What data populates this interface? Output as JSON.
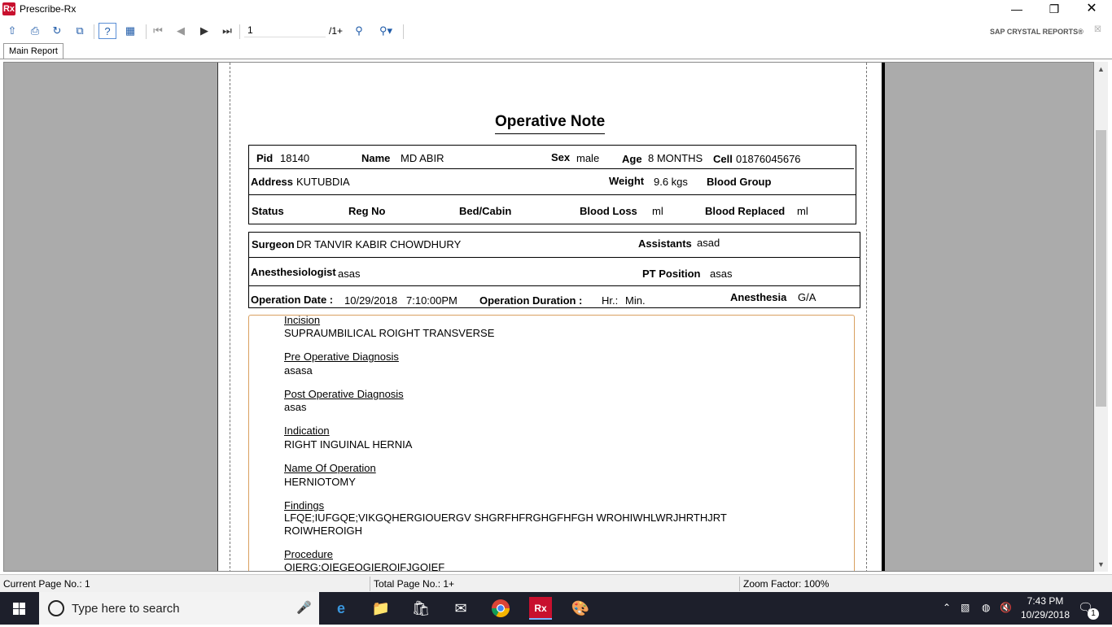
{
  "window": {
    "title": "Prescribe-Rx",
    "app_icon": "Rx"
  },
  "toolbar": {
    "page_input": "1",
    "page_total": "/1+",
    "brand": "SAP CRYSTAL REPORTS®"
  },
  "tabs": [
    {
      "label": "Main Report"
    }
  ],
  "report": {
    "title": "Operative Note",
    "patient": {
      "pid_label": "Pid",
      "pid": "18140",
      "name_label": "Name",
      "name": "MD ABIR",
      "sex_label": "Sex",
      "sex": "male",
      "age_label": "Age",
      "age": "8 MONTHS",
      "cell_label": "Cell",
      "cell": "01876045676",
      "address_label": "Address",
      "address": "KUTUBDIA",
      "weight_label": "Weight",
      "weight": "9.6 kgs",
      "blood_group_label": "Blood Group",
      "status_label": "Status",
      "reg_label": "Reg No",
      "bed_label": "Bed/Cabin",
      "blood_loss_label": "Blood Loss",
      "blood_loss_unit": "ml",
      "blood_replaced_label": "Blood Replaced",
      "blood_replaced_unit": "ml"
    },
    "operation": {
      "surgeon_label": "Surgeon",
      "surgeon": "DR TANVIR KABIR CHOWDHURY",
      "assistants_label": "Assistants",
      "assistants": "asad",
      "anesthesiologist_label": "Anesthesiologist",
      "anesthesiologist": "asas",
      "pt_position_label": "PT Position",
      "pt_position": "asas",
      "date_label": "Operation Date :",
      "date": "10/29/2018",
      "time": "7:10:00PM",
      "duration_label": "Operation Duration :",
      "duration_hr": "Hr.:",
      "duration_min": "Min.",
      "anesthesia_label": "Anesthesia",
      "anesthesia": "G/A"
    },
    "sections": [
      {
        "heading": "Incision",
        "lines": [
          "SUPRAUMBILICAL ROIGHT TRANSVERSE"
        ]
      },
      {
        "heading": "Pre Operative Diagnosis",
        "lines": [
          "asasa"
        ]
      },
      {
        "heading": "Post Operative Diagnosis",
        "lines": [
          "asas"
        ]
      },
      {
        "heading": "Indication",
        "lines": [
          "RIGHT INGUINAL HERNIA"
        ]
      },
      {
        "heading": "Name Of Operation",
        "lines": [
          "HERNIOTOMY"
        ]
      },
      {
        "heading": "Findings",
        "lines": [
          "LFQE;IUFGQE;VIKGQHERGIOUERGV  SHGRFHFRGHGFHFGH  WROHIWHLWRJHRTHJRT",
          "ROIWHEROIGH"
        ]
      },
      {
        "heading": "Procedure",
        "lines": [
          "OIERG;OIEGEOGIEROIFJGOIEF"
        ]
      }
    ]
  },
  "statusbar": {
    "current_page": "Current Page No.: 1",
    "total_page": "Total Page No.: 1+",
    "zoom": "Zoom Factor: 100%"
  },
  "taskbar": {
    "search_placeholder": "Type here to search",
    "time": "7:43 PM",
    "date": "10/29/2018",
    "notification_count": "1"
  }
}
